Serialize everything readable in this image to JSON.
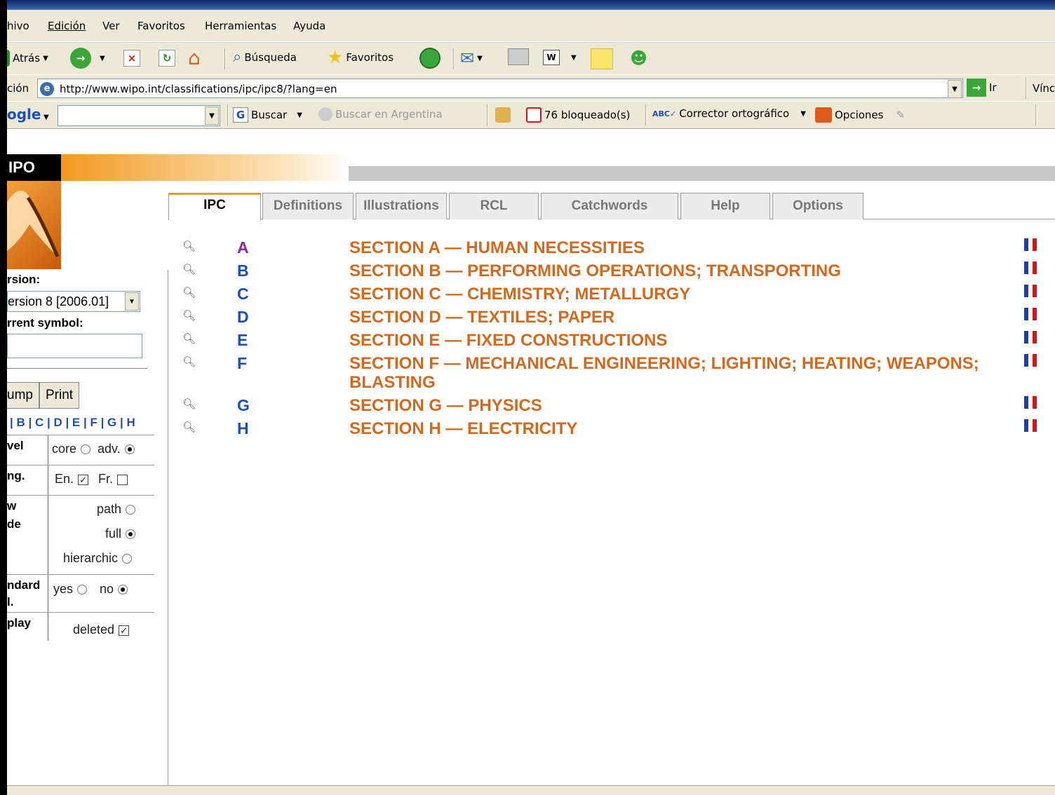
{
  "menu": [
    "hivo",
    "Edición",
    "Ver",
    "Favoritos",
    "Herramientas",
    "Ayuda"
  ],
  "toolbar": {
    "back": "Atrás",
    "search": "Búsqueda",
    "favorites": "Favoritos"
  },
  "address": {
    "label": "ción",
    "url": "http://www.wipo.int/classifications/ipc/ipc8/?lang=en",
    "go": "Ir",
    "links": "Vínc"
  },
  "google": {
    "logo": "ogle",
    "search": "Buscar",
    "search_argentina": "Buscar en Argentina",
    "blocked": "76 bloqueado(s)",
    "spell": "Corrector ortográfico",
    "options": "Opciones"
  },
  "brand": "IPO",
  "left": {
    "version_label": "rsion:",
    "version_value": "ersion 8 [2006.01]",
    "symbol_label": "rrent symbol:",
    "jump": "ump",
    "print": "Print",
    "letters": "| B | C | D | E | F | G | H",
    "level_label": "vel",
    "level_core": "core",
    "level_adv": "adv.",
    "lang_label": "ng.",
    "lang_en": "En.",
    "lang_fr": "Fr.",
    "view_label1": "w",
    "view_label2": "de",
    "view_path": "path",
    "view_full": "full",
    "view_hier": "hierarchic",
    "std_label1": "ndard",
    "std_label2": "l.",
    "std_yes": "yes",
    "std_no": "no",
    "display_label": "play",
    "display_deleted": "deleted"
  },
  "tabs": [
    "IPC",
    "Definitions",
    "Illustrations",
    "RCL",
    "Catchwords",
    "Help",
    "Options"
  ],
  "sections": [
    {
      "letter": "A",
      "title": "SECTION A — HUMAN NECESSITIES"
    },
    {
      "letter": "B",
      "title": "SECTION B — PERFORMING OPERATIONS; TRANSPORTING"
    },
    {
      "letter": "C",
      "title": "SECTION C — CHEMISTRY; METALLURGY"
    },
    {
      "letter": "D",
      "title": "SECTION D — TEXTILES; PAPER"
    },
    {
      "letter": "E",
      "title": "SECTION E — FIXED CONSTRUCTIONS"
    },
    {
      "letter": "F",
      "title": "SECTION F — MECHANICAL ENGINEERING; LIGHTING; HEATING; WEAPONS; BLASTING"
    },
    {
      "letter": "G",
      "title": "SECTION G — PHYSICS"
    },
    {
      "letter": "H",
      "title": "SECTION H — ELECTRICITY"
    }
  ]
}
